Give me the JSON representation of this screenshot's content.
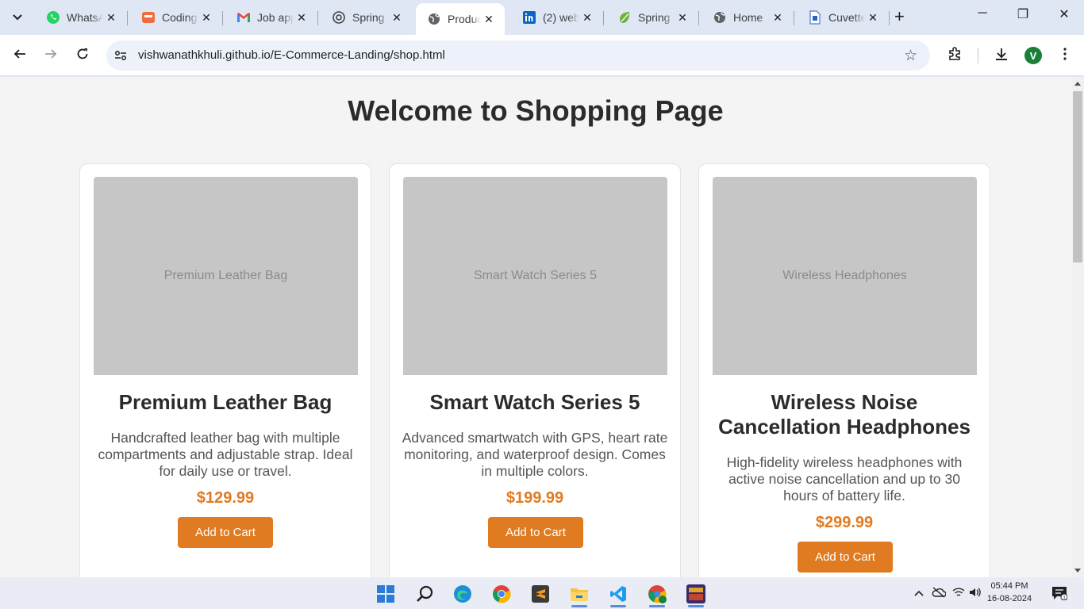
{
  "browser": {
    "tabs": [
      {
        "title": "WhatsApp",
        "icon": "whatsapp-icon",
        "active": false
      },
      {
        "title": "Coding",
        "icon": "coding-ninjas-icon",
        "active": false
      },
      {
        "title": "Job application",
        "icon": "gmail-icon",
        "active": false
      },
      {
        "title": "Spring",
        "icon": "openai-icon",
        "active": false
      },
      {
        "title": "Products",
        "icon": "globe-icon",
        "active": true
      },
      {
        "title": "(2) web",
        "icon": "linkedin-icon",
        "active": false
      },
      {
        "title": "Spring",
        "icon": "spring-icon",
        "active": false
      },
      {
        "title": "Home",
        "icon": "globe-icon",
        "active": false
      },
      {
        "title": "Cuvette",
        "icon": "cuvette-icon",
        "active": false
      }
    ],
    "url": "vishwanathkhuli.github.io/E-Commerce-Landing/shop.html",
    "profile_initial": "V",
    "window_controls": {
      "minimize": "─",
      "restore": "❐",
      "close": "✕"
    },
    "new_tab_label": "+"
  },
  "page": {
    "heading": "Welcome to Shopping Page",
    "products": [
      {
        "image_alt": "Premium Leather Bag",
        "name": "Premium Leather Bag",
        "description": "Handcrafted leather bag with multiple compartments and adjustable strap. Ideal for daily use or travel.",
        "price": "$129.99",
        "button": "Add to Cart"
      },
      {
        "image_alt": "Smart Watch Series 5",
        "name": "Smart Watch Series 5",
        "description": "Advanced smartwatch with GPS, heart rate monitoring, and waterproof design. Comes in multiple colors.",
        "price": "$199.99",
        "button": "Add to Cart"
      },
      {
        "image_alt": "Wireless Headphones",
        "name": "Wireless Noise Cancellation Headphones",
        "description": "High-fidelity wireless headphones with active noise cancellation and up to 30 hours of battery life.",
        "price": "$299.99",
        "button": "Add to Cart"
      }
    ]
  },
  "taskbar": {
    "apps": [
      "windows-start-icon",
      "search-icon",
      "edge-icon",
      "chrome-icon",
      "sublime-text-icon",
      "file-explorer-icon",
      "vscode-icon",
      "chrome-profile-icon",
      "game-icon"
    ],
    "time": "05:44 PM",
    "date": "16-08-2024"
  },
  "colors": {
    "accent": "#e07b21",
    "tab_strip": "#dfe7f5",
    "page_bg": "#f4f4f4"
  }
}
